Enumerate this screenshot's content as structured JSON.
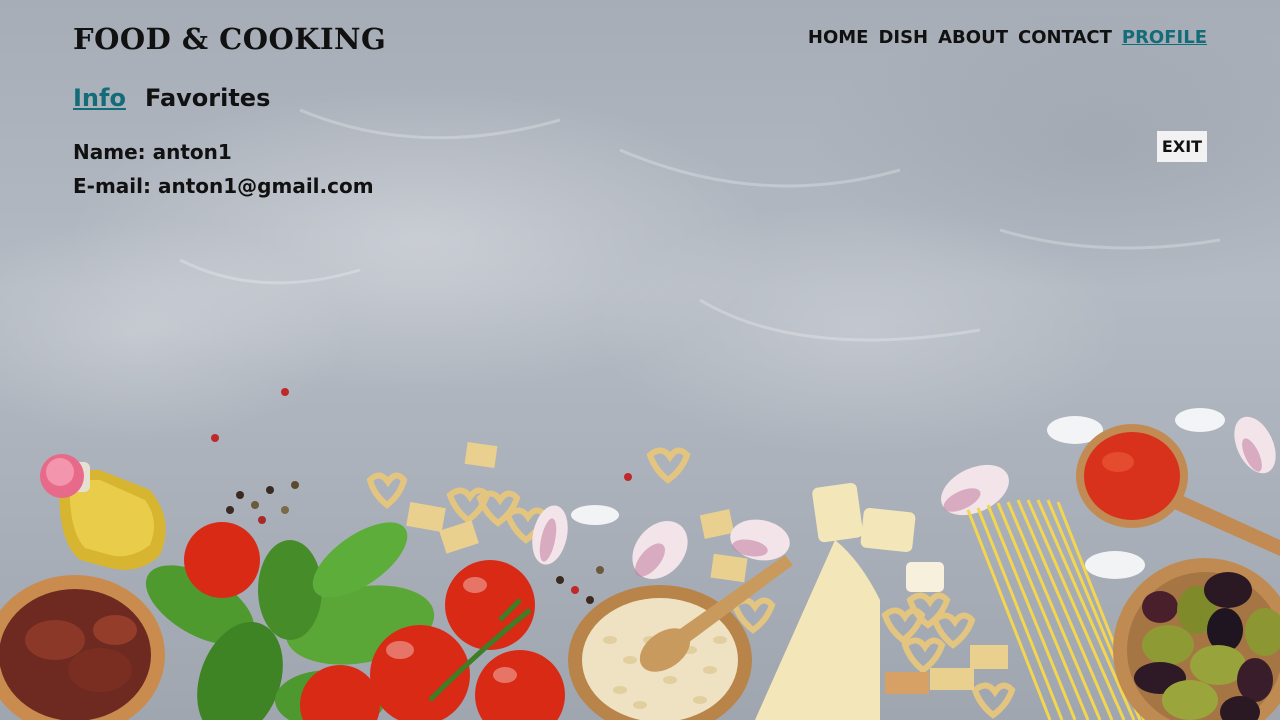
{
  "header": {
    "logo": "FOOD & COOKING",
    "nav": [
      {
        "label": "HOME"
      },
      {
        "label": "DISH"
      },
      {
        "label": "ABOUT"
      },
      {
        "label": "CONTACT"
      },
      {
        "label": "PROFILE",
        "active": true
      }
    ]
  },
  "profile": {
    "tabs": [
      {
        "label": "Info",
        "active": true
      },
      {
        "label": "Favorites"
      }
    ],
    "name_line": "Name: anton1",
    "email_line": "E-mail: anton1@gmail.com",
    "exit_label": "EXIT"
  },
  "colors": {
    "accent": "#136c78",
    "text": "#111111",
    "background": "#a9b0b9"
  },
  "background_image": "food ingredients on grey stone background"
}
